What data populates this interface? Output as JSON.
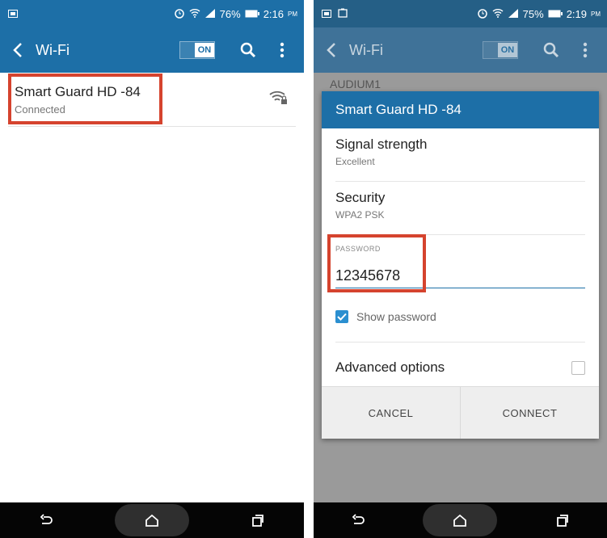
{
  "left": {
    "status": {
      "battery": "76%",
      "time": "2:16",
      "ampm": "PM"
    },
    "appbar": {
      "title": "Wi-Fi",
      "toggle": "ON"
    },
    "network": {
      "name": "Smart Guard HD -84",
      "status": "Connected"
    }
  },
  "right": {
    "status": {
      "battery": "75%",
      "time": "2:19",
      "ampm": "PM"
    },
    "appbar": {
      "title": "Wi-Fi",
      "toggle": "ON"
    },
    "bg_item": "AUDIUM1",
    "dialog": {
      "title": "Smart Guard HD -84",
      "signal_label": "Signal strength",
      "signal_value": "Excellent",
      "security_label": "Security",
      "security_value": "WPA2 PSK",
      "password_label": "PASSWORD",
      "password_value": "12345678",
      "show_password": "Show password",
      "advanced": "Advanced options",
      "cancel": "CANCEL",
      "connect": "CONNECT"
    }
  },
  "colors": {
    "appbar": "#1d6fa7",
    "highlight": "#d5432e",
    "checkbox": "#2b8fd0"
  }
}
